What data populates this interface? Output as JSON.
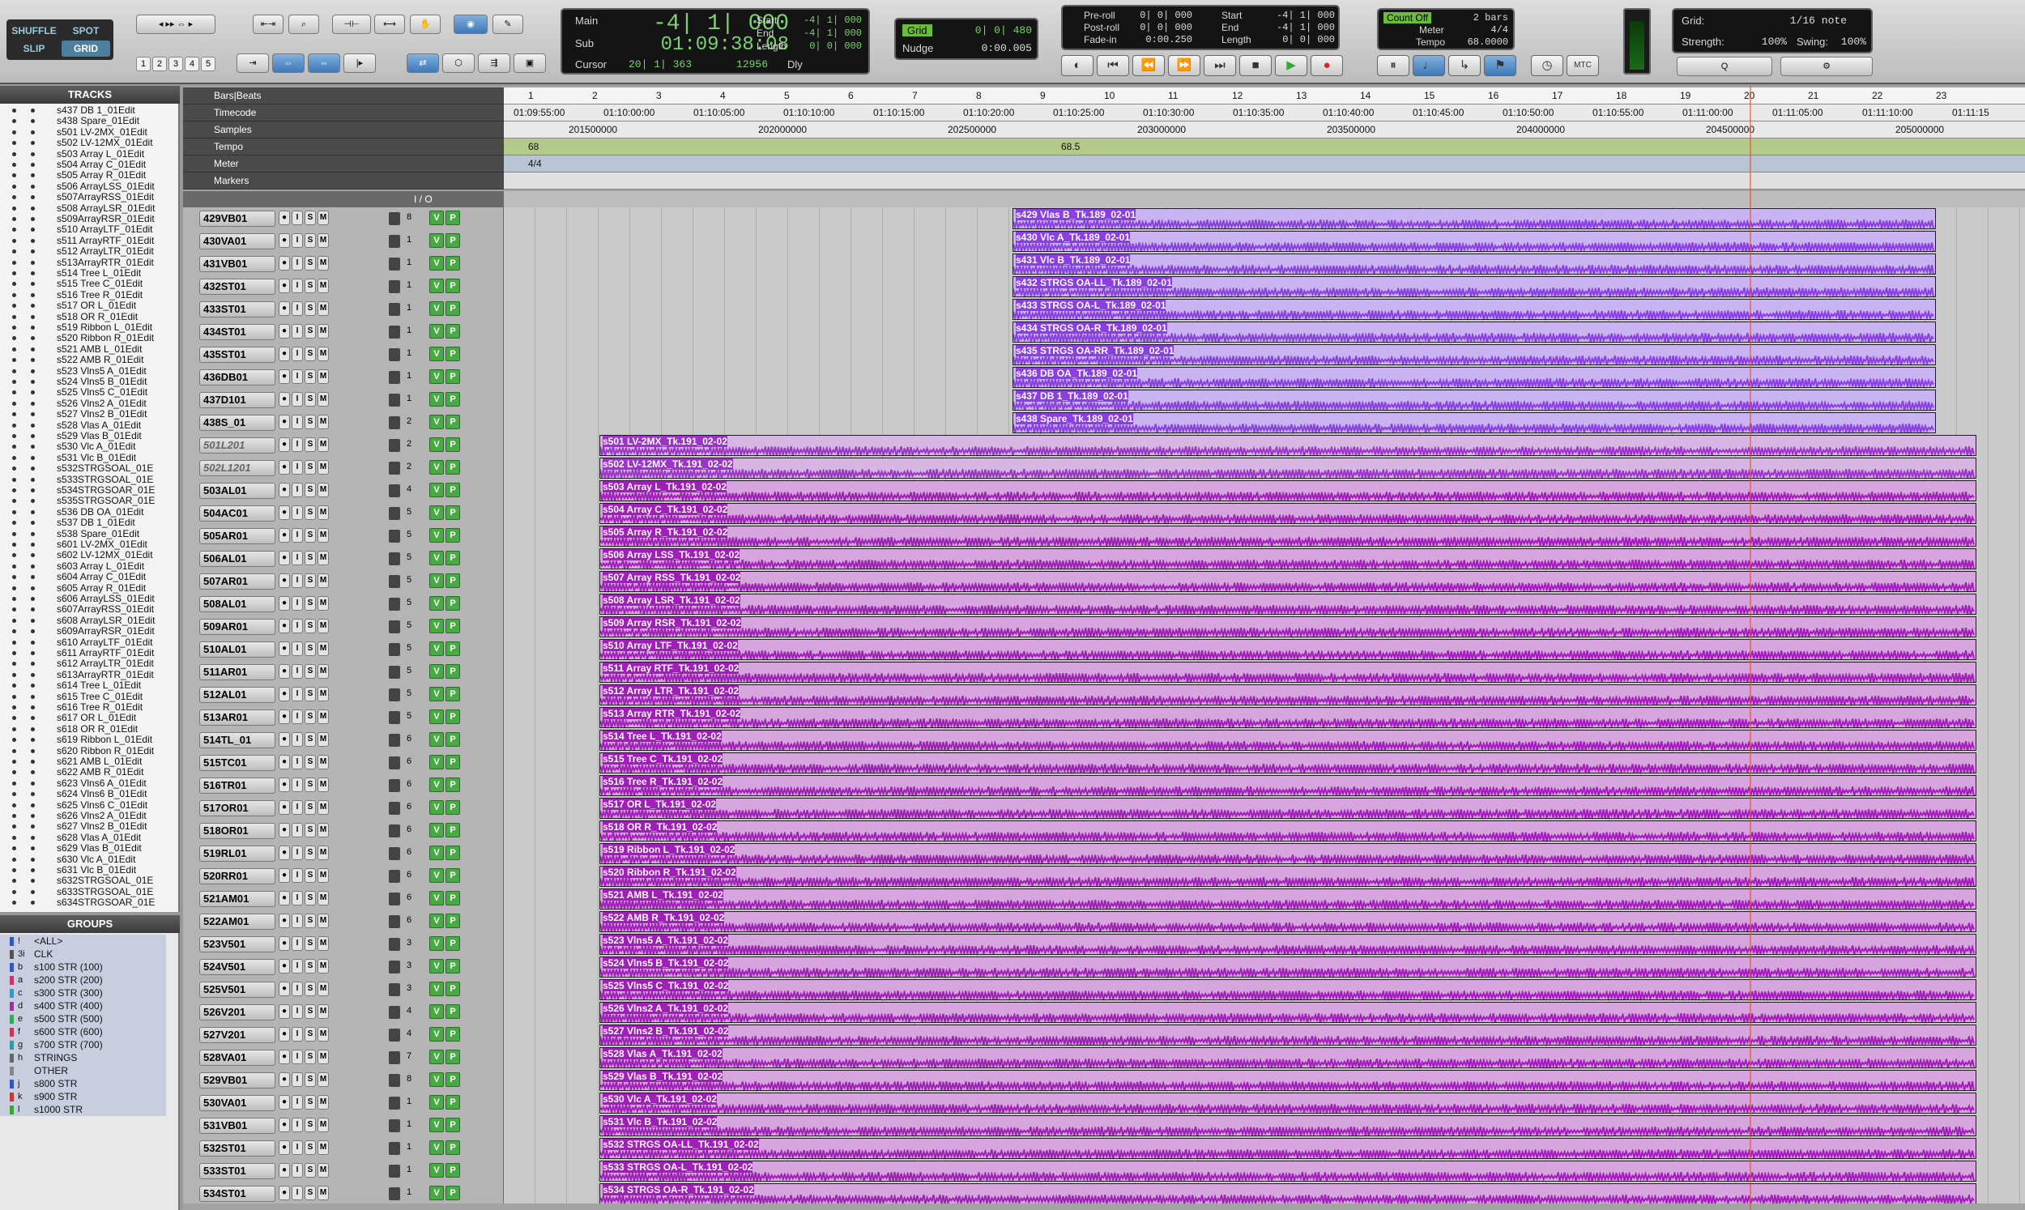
{
  "toolbar": {
    "modes": [
      "SHUFFLE",
      "SPOT",
      "SLIP",
      "GRID"
    ],
    "zoom_presets": [
      "1",
      "2",
      "3",
      "4",
      "5"
    ],
    "counters": {
      "main_label": "Main",
      "sub_label": "Sub",
      "main_value": "-4| 1| 000",
      "sub_value": "01:09:38:08",
      "cursor_label": "Cursor",
      "cursor_value": "20| 1| 363",
      "samples_value": "12956",
      "dly_label": "Dly",
      "start_label": "Start",
      "end_label": "End",
      "length_label": "Length",
      "start_value": "-4| 1| 000",
      "end_value": "-4| 1| 000",
      "length_value": "0| 0| 000"
    },
    "grid_box": {
      "grid_label": "Grid",
      "grid_value": "0| 0| 480",
      "nudge_label": "Nudge",
      "nudge_value": "0:00.005"
    },
    "preroll": {
      "pre_label": "Pre-roll",
      "post_label": "Post-roll",
      "fade_label": "Fade-in",
      "pre_value": "0| 0| 000",
      "post_value": "0| 0| 000",
      "fade_value": "0:00.250",
      "start_label": "Start",
      "end_label": "End",
      "length_label": "Length",
      "start_value": "-4| 1| 000",
      "end_value": "-4| 1| 000",
      "length_value": "0| 0| 000"
    },
    "count": {
      "count_off": "Count Off",
      "bars": "2 bars",
      "meter_label": "Meter",
      "meter_value": "4/4",
      "tempo_label": "Tempo",
      "tempo_value": "68.0000"
    },
    "mtc_label": "MTC",
    "grid_settings": {
      "grid_label": "Grid:",
      "grid_value": "1/16 note",
      "strength_label": "Strength:",
      "strength_value": "100%",
      "swing_label": "Swing:",
      "swing_value": "100%"
    }
  },
  "tracks_panel": {
    "title": "TRACKS",
    "items": [
      "s437 DB 1_01Edit",
      "s438 Spare_01Edit",
      "s501 LV-2MX_01Edit",
      "s502 LV-12MX_01Edit",
      "s503 Array L_01Edit",
      "s504 Array C_01Edit",
      "s505 Array R_01Edit",
      "s506 ArrayLSS_01Edit",
      "s507ArrayRSS_01Edit",
      "s508 ArrayLSR_01Edit",
      "s509ArrayRSR_01Edit",
      "s510 ArrayLTF_01Edit",
      "s511 ArrayRTF_01Edit",
      "s512 ArrayLTR_01Edit",
      "s513ArrayRTR_01Edit",
      "s514 Tree L_01Edit",
      "s515 Tree C_01Edit",
      "s516 Tree R_01Edit",
      "s517 OR L_01Edit",
      "s518 OR R_01Edit",
      "s519 Ribbon L_01Edit",
      "s520 Ribbon R_01Edit",
      "s521 AMB L_01Edit",
      "s522 AMB R_01Edit",
      "s523 Vlns5 A_01Edit",
      "s524 Vlns5 B_01Edit",
      "s525 Vlns5 C_01Edit",
      "s526 Vlns2 A_01Edit",
      "s527 Vlns2 B_01Edit",
      "s528 Vlas A_01Edit",
      "s529 Vlas B_01Edit",
      "s530 Vlc A_01Edit",
      "s531 Vlc B_01Edit",
      "s532STRGSOAL_01E",
      "s533STRGSOAL_01E",
      "s534STRGSOAR_01E",
      "s535STRGSOAR_01E",
      "s536 DB OA_01Edit",
      "s537 DB 1_01Edit",
      "s538 Spare_01Edit",
      "s601 LV-2MX_01Edit",
      "s602 LV-12MX_01Edit",
      "s603 Array L_01Edit",
      "s604 Array C_01Edit",
      "s605 Array R_01Edit",
      "s606 ArrayLSS_01Edit",
      "s607ArrayRSS_01Edit",
      "s608 ArrayLSR_01Edit",
      "s609ArrayRSR_01Edit",
      "s610 ArrayLTF_01Edit",
      "s611 ArrayRTF_01Edit",
      "s612 ArrayLTR_01Edit",
      "s613ArrayRTR_01Edit",
      "s614 Tree L_01Edit",
      "s615 Tree C_01Edit",
      "s616 Tree R_01Edit",
      "s617 OR L_01Edit",
      "s618 OR R_01Edit",
      "s619 Ribbon L_01Edit",
      "s620 Ribbon R_01Edit",
      "s621 AMB L_01Edit",
      "s622 AMB R_01Edit",
      "s623 Vlns6 A_01Edit",
      "s624 Vlns6 B_01Edit",
      "s625 Vlns6 C_01Edit",
      "s626 Vlns2 A_01Edit",
      "s627 Vlns2 B_01Edit",
      "s628 Vlas A_01Edit",
      "s629 Vlas B_01Edit",
      "s630 Vlc A_01Edit",
      "s631 Vlc B_01Edit",
      "s632STRGSOAL_01E",
      "s633STRGSOAL_01E",
      "s634STRGSOAR_01E"
    ]
  },
  "groups_panel": {
    "title": "GROUPS",
    "items": [
      {
        "key": "!",
        "label": "<ALL>",
        "color": "#3355cc"
      },
      {
        "key": "3i",
        "label": "CLK",
        "color": "#555"
      },
      {
        "key": "b",
        "label": "s100 STR (100)",
        "color": "#3355cc"
      },
      {
        "key": "a",
        "label": "s200 STR (200)",
        "color": "#cc3366"
      },
      {
        "key": "c",
        "label": "s300 STR (300)",
        "color": "#3399cc"
      },
      {
        "key": "d",
        "label": "s400 STR (400)",
        "color": "#993399"
      },
      {
        "key": "e",
        "label": "s500 STR (500)",
        "color": "#33aa55"
      },
      {
        "key": "f",
        "label": "s600 STR (600)",
        "color": "#cc3355"
      },
      {
        "key": "g",
        "label": "s700 STR (700)",
        "color": "#3399aa"
      },
      {
        "key": "h",
        "label": "STRINGS",
        "color": "#666"
      },
      {
        "key": "",
        "label": "OTHER",
        "color": "#888"
      },
      {
        "key": "j",
        "label": "s800 STR",
        "color": "#3355cc"
      },
      {
        "key": "k",
        "label": "s900 STR",
        "color": "#cc3333"
      },
      {
        "key": "l",
        "label": "s1000 STR",
        "color": "#33aa33"
      }
    ]
  },
  "rulers": {
    "labels": [
      "Bars|Beats",
      "Timecode",
      "Samples",
      "Tempo",
      "Meter",
      "Markers"
    ],
    "bars": [
      "1",
      "2",
      "3",
      "4",
      "5",
      "6",
      "7",
      "8",
      "9",
      "10",
      "11",
      "12",
      "13",
      "14",
      "15",
      "16",
      "17",
      "18",
      "19",
      "20",
      "21",
      "22",
      "23"
    ],
    "timecode": [
      "01:09:55:00",
      "01:10:00:00",
      "01:10:05:00",
      "01:10:10:00",
      "01:10:15:00",
      "01:10:20:00",
      "01:10:25:00",
      "01:10:30:00",
      "01:10:35:00",
      "01:10:40:00",
      "01:10:45:00",
      "01:10:50:00",
      "01:10:55:00",
      "01:11:00:00",
      "01:11:05:00",
      "01:11:10:00",
      "01:11:15"
    ],
    "samples": [
      "201500000",
      "202000000",
      "202500000",
      "203000000",
      "203500000",
      "204000000",
      "204500000",
      "205000000"
    ],
    "tempo_marks": [
      "68",
      "68.5"
    ],
    "meter_value": "4/4",
    "io_label": "I / O"
  },
  "tracks": [
    {
      "name": "429VB01",
      "ch": "8",
      "clip": "s429 Vlas B_Tk.189_02-01",
      "group": "a"
    },
    {
      "name": "430VA01",
      "ch": "1",
      "clip": "s430 Vlc A_Tk.189_02-01",
      "group": "a"
    },
    {
      "name": "431VB01",
      "ch": "1",
      "clip": "s431 Vlc B_Tk.189_02-01",
      "group": "a"
    },
    {
      "name": "432ST01",
      "ch": "1",
      "clip": "s432 STRGS OA-LL_Tk.189_02-01",
      "group": "a"
    },
    {
      "name": "433ST01",
      "ch": "1",
      "clip": "s433 STRGS OA-L_Tk.189_02-01",
      "group": "a"
    },
    {
      "name": "434ST01",
      "ch": "1",
      "clip": "s434 STRGS OA-R_Tk.189_02-01",
      "group": "a"
    },
    {
      "name": "435ST01",
      "ch": "1",
      "clip": "s435 STRGS OA-RR_Tk.189_02-01",
      "group": "a"
    },
    {
      "name": "436DB01",
      "ch": "1",
      "clip": "s436 DB OA_Tk.189_02-01",
      "group": "a"
    },
    {
      "name": "437D101",
      "ch": "1",
      "clip": "s437 DB 1_Tk.189_02-01",
      "group": "a"
    },
    {
      "name": "438S_01",
      "ch": "2",
      "clip": "s438 Spare_Tk.189_02-01",
      "group": "a"
    },
    {
      "name": "501L201",
      "ch": "2",
      "clip": "s501 LV-2MX_Tk.191_02-02",
      "group": "b"
    },
    {
      "name": "502L1201",
      "ch": "2",
      "clip": "s502 LV-12MX_Tk.191_02-02",
      "group": "b"
    },
    {
      "name": "503AL01",
      "ch": "4",
      "clip": "s503 Array L_Tk.191_02-02",
      "group": "c"
    },
    {
      "name": "504AC01",
      "ch": "5",
      "clip": "s504 Array C_Tk.191_02-02",
      "group": "c"
    },
    {
      "name": "505AR01",
      "ch": "5",
      "clip": "s505 Array R_Tk.191_02-02",
      "group": "c"
    },
    {
      "name": "506AL01",
      "ch": "5",
      "clip": "s506 Array LSS_Tk.191_02-02",
      "group": "c"
    },
    {
      "name": "507AR01",
      "ch": "5",
      "clip": "s507 Array RSS_Tk.191_02-02",
      "group": "c"
    },
    {
      "name": "508AL01",
      "ch": "5",
      "clip": "s508 Array LSR_Tk.191_02-02",
      "group": "c"
    },
    {
      "name": "509AR01",
      "ch": "5",
      "clip": "s509 Array RSR_Tk.191_02-02",
      "group": "c"
    },
    {
      "name": "510AL01",
      "ch": "5",
      "clip": "s510 Array LTF_Tk.191_02-02",
      "group": "c"
    },
    {
      "name": "511AR01",
      "ch": "5",
      "clip": "s511 Array RTF_Tk.191_02-02",
      "group": "c"
    },
    {
      "name": "512AL01",
      "ch": "5",
      "clip": "s512 Array LTR_Tk.191_02-02",
      "group": "c"
    },
    {
      "name": "513AR01",
      "ch": "5",
      "clip": "s513 Array RTR_Tk.191_02-02",
      "group": "c"
    },
    {
      "name": "514TL_01",
      "ch": "6",
      "clip": "s514 Tree L_Tk.191_02-02",
      "group": "c"
    },
    {
      "name": "515TC01",
      "ch": "6",
      "clip": "s515 Tree C_Tk.191_02-02",
      "group": "c"
    },
    {
      "name": "516TR01",
      "ch": "6",
      "clip": "s516 Tree R_Tk.191_02-02",
      "group": "c"
    },
    {
      "name": "517OR01",
      "ch": "6",
      "clip": "s517 OR L_Tk.191_02-02",
      "group": "c"
    },
    {
      "name": "518OR01",
      "ch": "6",
      "clip": "s518 OR R_Tk.191_02-02",
      "group": "c"
    },
    {
      "name": "519RL01",
      "ch": "6",
      "clip": "s519 Ribbon L_Tk.191_02-02",
      "group": "c"
    },
    {
      "name": "520RR01",
      "ch": "6",
      "clip": "s520 Ribbon R_Tk.191_02-02",
      "group": "c"
    },
    {
      "name": "521AM01",
      "ch": "6",
      "clip": "s521 AMB L_Tk.191_02-02",
      "group": "c"
    },
    {
      "name": "522AM01",
      "ch": "6",
      "clip": "s522 AMB R_Tk.191_02-02",
      "group": "c"
    },
    {
      "name": "523V501",
      "ch": "3",
      "clip": "s523 Vlns5 A_Tk.191_02-02",
      "group": "c"
    },
    {
      "name": "524V501",
      "ch": "3",
      "clip": "s524 Vlns5 B_Tk.191_02-02",
      "group": "c"
    },
    {
      "name": "525V501",
      "ch": "3",
      "clip": "s525 Vlns5 C_Tk.191_02-02",
      "group": "c"
    },
    {
      "name": "526V201",
      "ch": "4",
      "clip": "s526 Vlns2 A_Tk.191_02-02",
      "group": "c"
    },
    {
      "name": "527V201",
      "ch": "4",
      "clip": "s527 Vlns2 B_Tk.191_02-02",
      "group": "c"
    },
    {
      "name": "528VA01",
      "ch": "7",
      "clip": "s528 Vlas A_Tk.191_02-02",
      "group": "c"
    },
    {
      "name": "529VB01",
      "ch": "8",
      "clip": "s529 Vlas B_Tk.191_02-02",
      "group": "c"
    },
    {
      "name": "530VA01",
      "ch": "1",
      "clip": "s530 Vlc A_Tk.191_02-02",
      "group": "c"
    },
    {
      "name": "531VB01",
      "ch": "1",
      "clip": "s531 Vlc B_Tk.191_02-02",
      "group": "c"
    },
    {
      "name": "532ST01",
      "ch": "1",
      "clip": "s532 STRGS OA-LL_Tk.191_02-02",
      "group": "c"
    },
    {
      "name": "533ST01",
      "ch": "1",
      "clip": "s533 STRGS OA-L_Tk.191_02-02",
      "group": "c"
    },
    {
      "name": "534ST01",
      "ch": "1",
      "clip": "s534 STRGS OA-R_Tk.191_02-02",
      "group": "c"
    }
  ],
  "colors": {
    "clip_a": "#8a3fe0",
    "clip_a_bg": "#c9b3f0",
    "clip_b": "#9b35c8",
    "clip_b_bg": "#d8b6e4",
    "clip_c": "#a01fb8",
    "clip_c_bg": "#d7a5de",
    "counter_green": "#7bd36f"
  }
}
